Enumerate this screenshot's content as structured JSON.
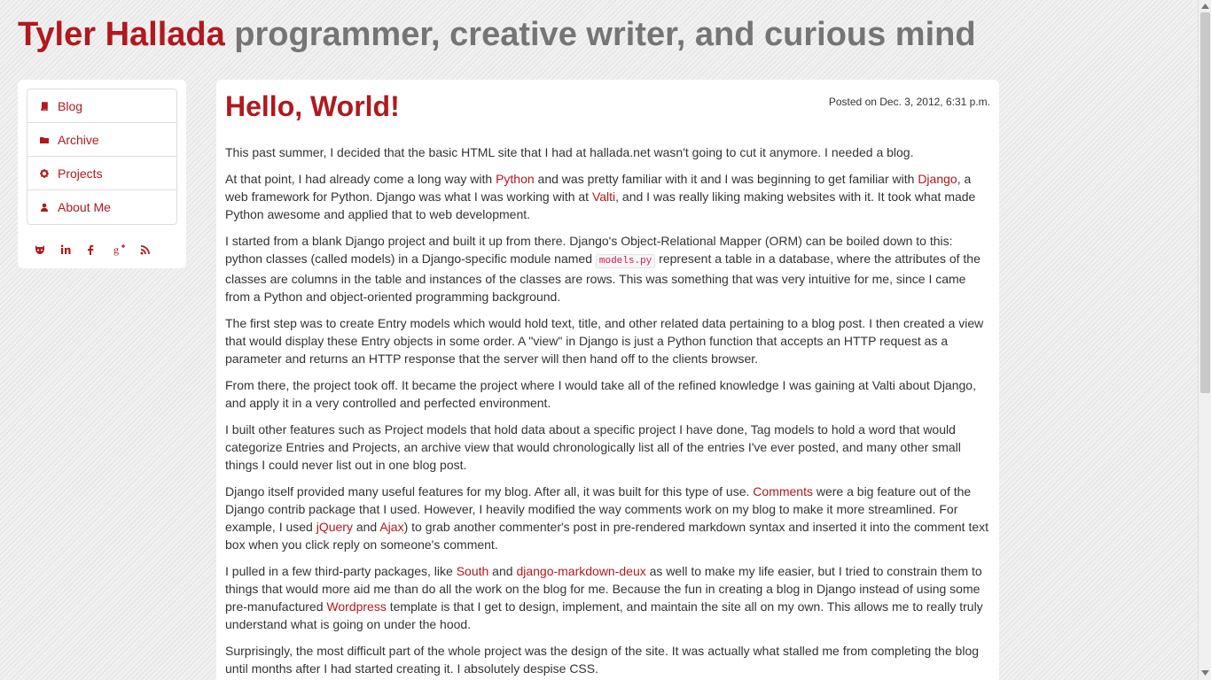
{
  "header": {
    "name": "Tyler Hallada",
    "tagline": "programmer, creative writer, and curious mind"
  },
  "sidebar": {
    "nav": [
      {
        "label": "Blog",
        "icon": "book-icon"
      },
      {
        "label": "Archive",
        "icon": "folder-icon"
      },
      {
        "label": "Projects",
        "icon": "gear-icon"
      },
      {
        "label": "About Me",
        "icon": "user-icon"
      }
    ],
    "social": [
      "github-icon",
      "linkedin-icon",
      "facebook-icon",
      "google-plus-icon",
      "rss-icon"
    ]
  },
  "post": {
    "title": "Hello, World!",
    "date": "Posted on Dec. 3, 2012, 6:31 p.m.",
    "p1": "This past summer, I decided that the basic HTML site that I had at hallada.net wasn't going to cut it anymore. I needed a blog.",
    "p2": {
      "a": "At that point, I had already come a long way with ",
      "link1": "Python",
      "b": " and was pretty familiar with it and I was beginning to get familiar with ",
      "link2": "Django",
      "c": ", a web framework for Python. Django was what I was working with at ",
      "link3": "Valti",
      "d": ", and I was really liking making websites with it. It took what made Python awesome and applied that to web development."
    },
    "p3": {
      "a": "I started from a blank Django project and built it up from there. Django's Object-Relational Mapper (ORM) can be boiled down to this: python classes (called models) in a Django-specific module named ",
      "code": "models.py",
      "b": " represent a table in a database, where the attributes of the classes are columns in the table and instances of the classes are rows. This was something that was very intuitive for me, since I came from a Python and object-oriented programming background."
    },
    "p4": "The first step was to create Entry models which would hold text, title, and other related data pertaining to a blog post. I then created a view that would display these Entry objects in some order. A \"view\" in Django is just a Python function that accepts an HTTP request as a parameter and returns an HTTP response that the server will then hand off to the clients browser.",
    "p5": "From there, the project took off. It became the project where I would take all of the refined knowledge I was gaining at Valti about Django, and apply it in a very controlled and perfected environment.",
    "p6": "I built other features such as Project models that hold data about a specific project I have done, Tag models to hold a word that would categorize Entries and Projects, an archive view that would chronologically list all of the entries I've ever posted, and many other small things I could never list out in one blog post.",
    "p7": {
      "a": "Django itself provided many useful features for my blog. After all, it was built for this type of use. ",
      "link1": "Comments",
      "b": " were a big feature out of the Django contrib package that I used. However, I heavily modified the way comments work on my blog to make it more streamlined. For example, I used ",
      "link2": "jQuery",
      "c": " and ",
      "link3": "Ajax",
      "d": ") to grab another commenter's post in pre-rendered markdown syntax and inserted it into the comment text box when you click reply on someone's comment."
    },
    "p8": {
      "a": "I pulled in a few third-party packages, like ",
      "link1": "South",
      "b": " and ",
      "link2": "django-markdown-deux",
      "c": " as well to make my life easier, but I tried to constrain them to things that would more aid me than do all the work on the blog for me. Because the fun in creating a blog in Django instead of using some pre-manufactured ",
      "link3": "Wordpress",
      "d": " template is that I get to design, implement, and maintain the site all on my own. This allows me to really truly understand what is going on under the hood."
    },
    "p9": "Surprisingly, the most difficult part of the whole project was the design of the site. It was actually what stalled me from completing the blog until months after I had started creating it. I absolutely despise CSS."
  },
  "colors": {
    "accent": "#b0191e",
    "tagline": "#757575"
  }
}
